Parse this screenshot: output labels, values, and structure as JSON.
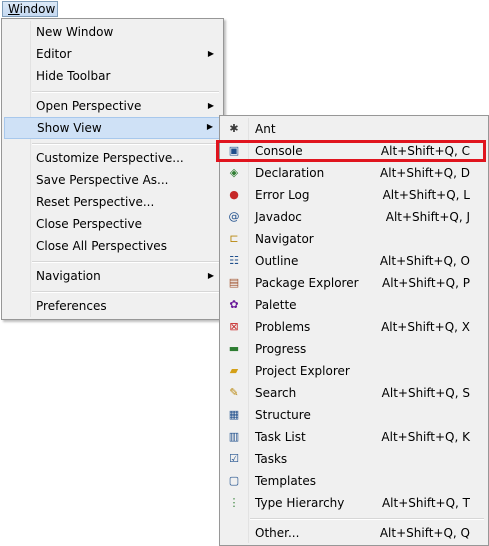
{
  "menubar": {
    "window_label_underlined": "W",
    "window_label_rest": "indow"
  },
  "window_menu": {
    "items": [
      {
        "label": "New Window"
      },
      {
        "label": "Editor",
        "submenu": true
      },
      {
        "label": "Hide Toolbar"
      },
      {
        "label": "Open Perspective",
        "submenu": true
      },
      {
        "label": "Show View",
        "submenu": true,
        "highlighted": true
      },
      {
        "label": "Customize Perspective..."
      },
      {
        "label": "Save Perspective As..."
      },
      {
        "label": "Reset Perspective..."
      },
      {
        "label": "Close Perspective"
      },
      {
        "label": "Close All Perspectives"
      },
      {
        "label": "Navigation",
        "submenu": true
      },
      {
        "label": "Preferences"
      }
    ],
    "arrow_glyph": "▶"
  },
  "show_view_menu": {
    "items": [
      {
        "label": "Ant",
        "shortcut": "",
        "icon": "ant-icon"
      },
      {
        "label": "Console",
        "shortcut": "Alt+Shift+Q, C",
        "icon": "console-icon"
      },
      {
        "label": "Declaration",
        "shortcut": "Alt+Shift+Q, D",
        "icon": "declaration-icon"
      },
      {
        "label": "Error Log",
        "shortcut": "Alt+Shift+Q, L",
        "icon": "error-log-icon"
      },
      {
        "label": "Javadoc",
        "shortcut": "Alt+Shift+Q, J",
        "icon": "javadoc-icon"
      },
      {
        "label": "Navigator",
        "shortcut": "",
        "icon": "navigator-icon"
      },
      {
        "label": "Outline",
        "shortcut": "Alt+Shift+Q, O",
        "icon": "outline-icon"
      },
      {
        "label": "Package Explorer",
        "shortcut": "Alt+Shift+Q, P",
        "icon": "package-explorer-icon"
      },
      {
        "label": "Palette",
        "shortcut": "",
        "icon": "palette-icon"
      },
      {
        "label": "Problems",
        "shortcut": "Alt+Shift+Q, X",
        "icon": "problems-icon"
      },
      {
        "label": "Progress",
        "shortcut": "",
        "icon": "progress-icon"
      },
      {
        "label": "Project Explorer",
        "shortcut": "",
        "icon": "project-explorer-icon"
      },
      {
        "label": "Search",
        "shortcut": "Alt+Shift+Q, S",
        "icon": "search-icon"
      },
      {
        "label": "Structure",
        "shortcut": "",
        "icon": "structure-icon"
      },
      {
        "label": "Task List",
        "shortcut": "Alt+Shift+Q, K",
        "icon": "task-list-icon"
      },
      {
        "label": "Tasks",
        "shortcut": "",
        "icon": "tasks-icon"
      },
      {
        "label": "Templates",
        "shortcut": "",
        "icon": "templates-icon"
      },
      {
        "label": "Type Hierarchy",
        "shortcut": "Alt+Shift+Q, T",
        "icon": "type-hierarchy-icon"
      },
      {
        "label": "Other...",
        "shortcut": "Alt+Shift+Q, Q",
        "icon": ""
      }
    ]
  },
  "colors": {
    "highlight_box": "#e0141e",
    "menu_bg": "#f0f0f0",
    "selection_bg": "#cfe1f6"
  }
}
